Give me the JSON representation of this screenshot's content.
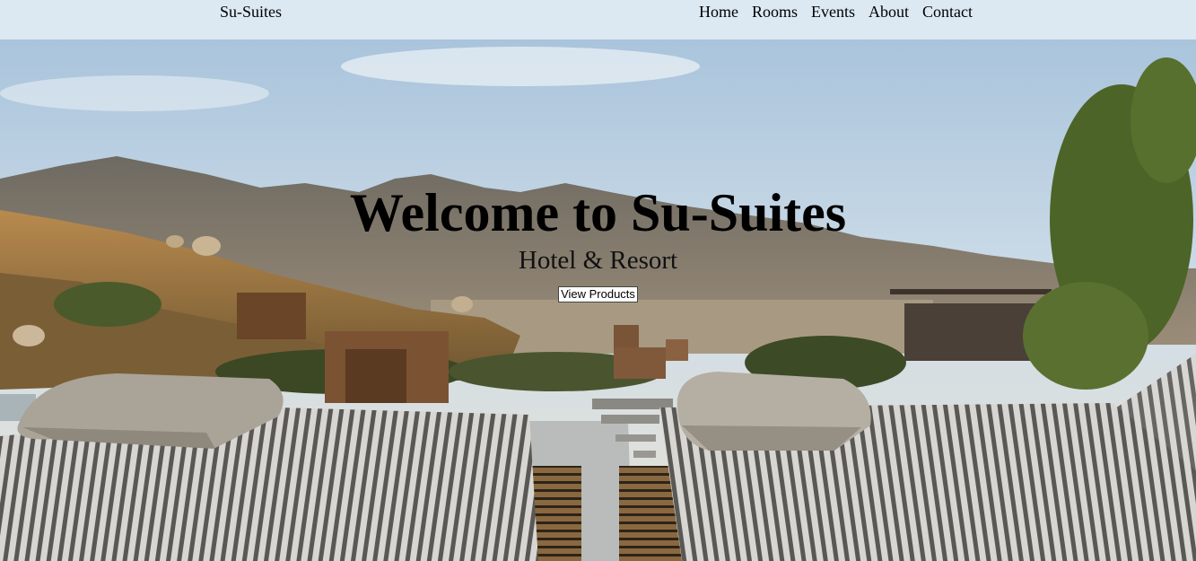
{
  "nav": {
    "brand": "Su-Suites",
    "links": [
      "Home",
      "Rooms",
      "Events",
      "About",
      "Contact"
    ]
  },
  "hero": {
    "title": "Welcome to Su-Suites",
    "subtitle": "Hotel & Resort",
    "cta_label": "View Products",
    "image": "hotel-poolside-loungers-mountain-view"
  },
  "colors": {
    "navbar_bg": "#dce9f3",
    "text": "#000000"
  }
}
